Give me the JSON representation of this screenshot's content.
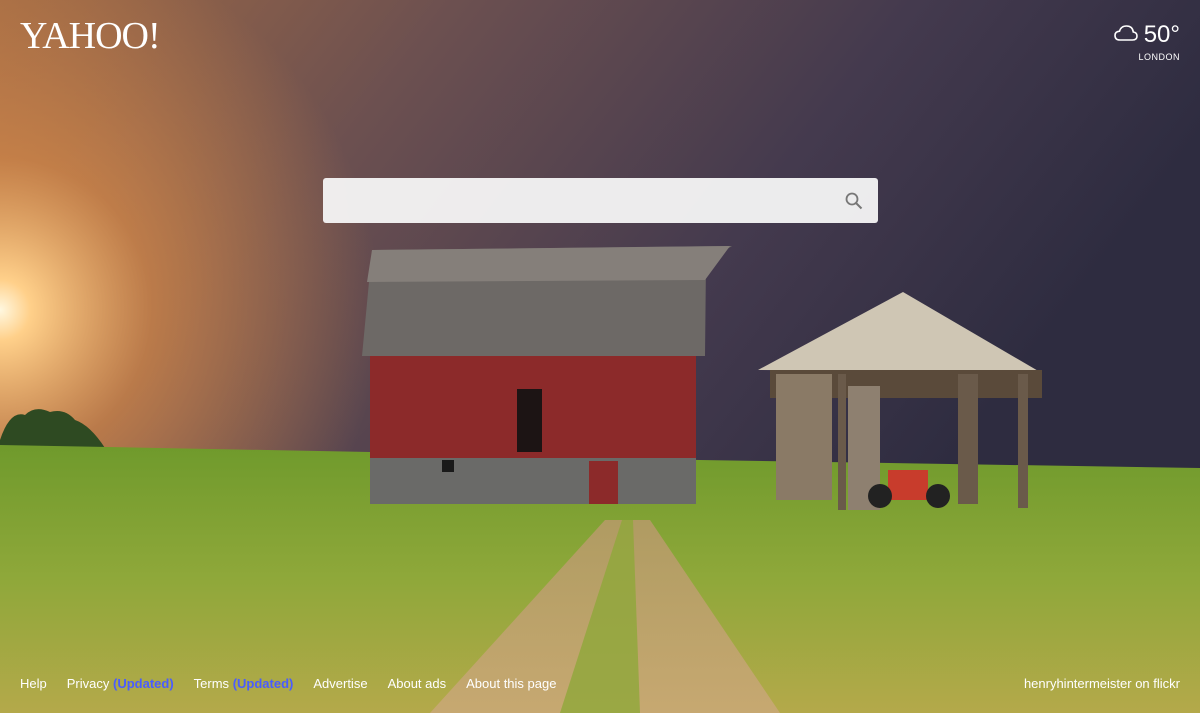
{
  "logo": {
    "text": "YAHOO!"
  },
  "weather": {
    "icon": "cloud-icon",
    "temperature": "50°",
    "city": "LONDON"
  },
  "search": {
    "value": "",
    "placeholder": "",
    "icon": "search-icon"
  },
  "footer": {
    "help": "Help",
    "privacy": "Privacy",
    "privacy_badge": "(Updated)",
    "terms": "Terms",
    "terms_badge": "(Updated)",
    "advertise": "Advertise",
    "about_ads": "About ads",
    "about_page": "About this page",
    "photo_credit": "henryhintermeister on flickr"
  },
  "colors": {
    "sky_dark": "#3a3045",
    "sky_warm": "#c98a5a",
    "grass": "#7a9b2e",
    "barn_red": "#8c2a2a"
  }
}
